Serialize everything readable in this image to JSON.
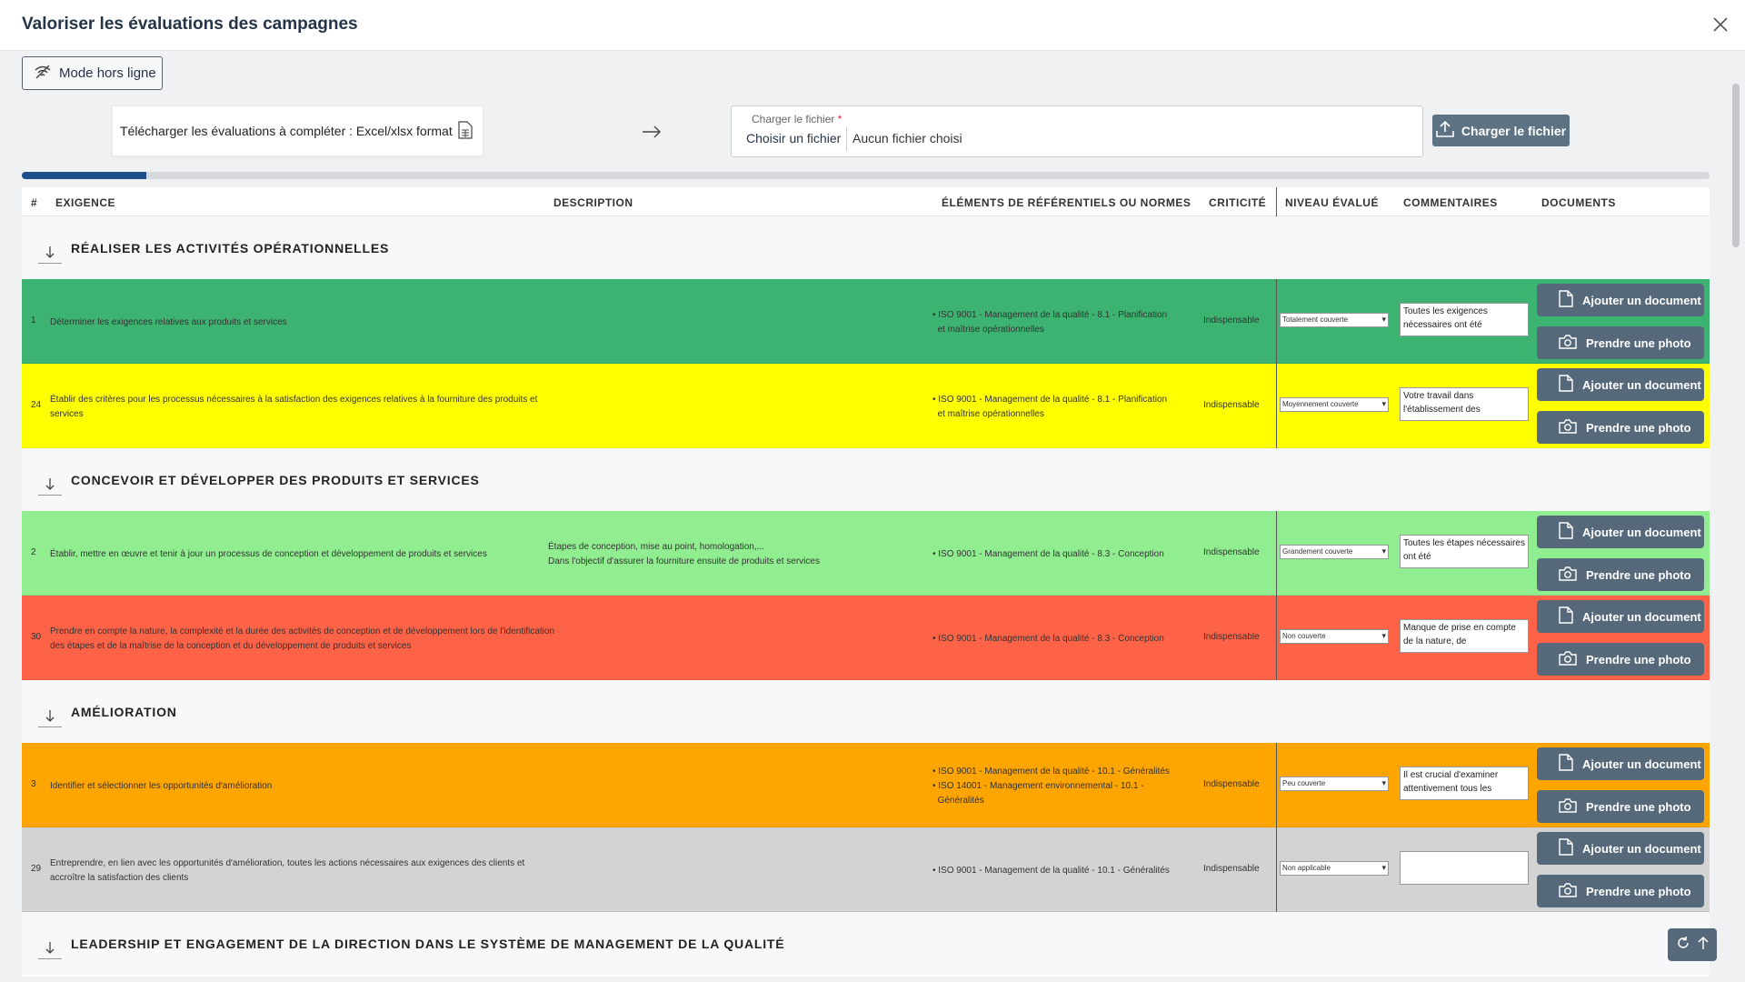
{
  "window": {
    "title": "Valoriser les évaluations des campagnes"
  },
  "toolbar": {
    "offline_label": "Mode hors ligne"
  },
  "download": {
    "label": "Télécharger les évaluations à compléter : Excel/xlsx format"
  },
  "upload": {
    "field_label": "Charger le fichier",
    "required_mark": "*",
    "choose_label": "Choisir un fichier",
    "no_file_text": "Aucun fichier choisi",
    "button_label": "Charger le fichier"
  },
  "progress": {
    "value": 0.074
  },
  "table": {
    "headers": {
      "num": "#",
      "requirement": "EXIGENCE",
      "description": "DESCRIPTION",
      "references": "ÉLÉMENTS DE RÉFÉRENTIELS OU NORMES",
      "criticality": "CRITICITÉ",
      "level": "NIVEAU ÉVALUÉ",
      "comments": "COMMENTAIRES",
      "documents": "DOCUMENTS"
    },
    "doc_button_label": "Ajouter un document",
    "photo_button_label": "Prendre une photo",
    "sections": [
      {
        "title": "RÉALISER LES ACTIVITÉS OPÉRATIONNELLES"
      },
      {
        "title": "CONCEVOIR ET DÉVELOPPER DES PRODUITS ET SERVICES"
      },
      {
        "title": "AMÉLIORATION"
      },
      {
        "title": "LEADERSHIP ET ENGAGEMENT DE LA DIRECTION DANS LE SYSTÈME DE MANAGEMENT DE LA QUALITÉ"
      }
    ],
    "rows": [
      {
        "num": "1",
        "requirement": "Déterminer les exigences relatives aux produits et services",
        "description": "",
        "references": "• ISO 9001 - Management de la qualité - 8.1 - Planification\n  et maîtrise opérationnelles",
        "criticality": "Indispensable",
        "level": "Totalement couverte",
        "comment": "Toutes les exigences nécessaires ont été",
        "color": "#3cb371"
      },
      {
        "num": "24",
        "requirement": "Établir des critères pour les processus nécessaires à la satisfaction des exigences relatives à la fourniture des produits et services",
        "description": "",
        "references": "• ISO 9001 - Management de la qualité - 8.1 - Planification\n  et maîtrise opérationnelles",
        "criticality": "Indispensable",
        "level": "Moyennement couverte",
        "comment": "Votre travail dans l'établissement des",
        "color": "#ffff00"
      },
      {
        "num": "2",
        "requirement": "Établir, mettre en œuvre et tenir à jour un processus de conception et développement de produits et services",
        "description": "Étapes de conception, mise au point, homologation,...\nDans l'objectif d'assurer la fourniture ensuite de produits et services",
        "references": "• ISO 9001 - Management de la qualité - 8.3 - Conception",
        "criticality": "Indispensable",
        "level": "Grandement couverte",
        "comment": "Toutes les étapes nécessaires ont été",
        "color": "#90ee90"
      },
      {
        "num": "30",
        "requirement": "Prendre en compte la nature, la complexité et la durée des activités de conception et de développement lors de l'identification des étapes et de la maîtrise de la conception et du développement de produits et services",
        "description": "",
        "references": "• ISO 9001 - Management de la qualité - 8.3 - Conception",
        "criticality": "Indispensable",
        "level": "Non couverte",
        "comment": "Manque de prise en compte de la nature, de",
        "color": "#ff6347"
      },
      {
        "num": "3",
        "requirement": "Identifier et sélectionner les opportunités d'amélioration",
        "description": "",
        "references": "• ISO 9001 - Management de la qualité - 10.1 - Généralités\n• ISO 14001 - Management environnemental - 10.1 -\n  Généralités",
        "criticality": "Indispensable",
        "level": "Peu couverte",
        "comment": "Il est crucial d'examiner attentivement tous les",
        "color": "#ffa500"
      },
      {
        "num": "29",
        "requirement": "Entreprendre, en lien avec les opportunités d'amélioration, toutes les actions nécessaires aux exigences des clients et accroître la satisfaction des clients",
        "description": "",
        "references": "• ISO 9001 - Management de la qualité - 10.1 - Généralités",
        "criticality": "Indispensable",
        "level": "Non applicable",
        "comment": "",
        "color": "#d3d3d3"
      }
    ]
  },
  "icons": {
    "close": "close-icon",
    "offline": "wifi-off-icon",
    "file": "spreadsheet-icon",
    "arrow": "arrow-right-icon",
    "upload": "upload-icon",
    "collapse": "arrow-down-icon",
    "document": "document-icon",
    "camera": "camera-icon",
    "refresh": "refresh-icon",
    "scroll_top": "arrow-up-icon"
  }
}
